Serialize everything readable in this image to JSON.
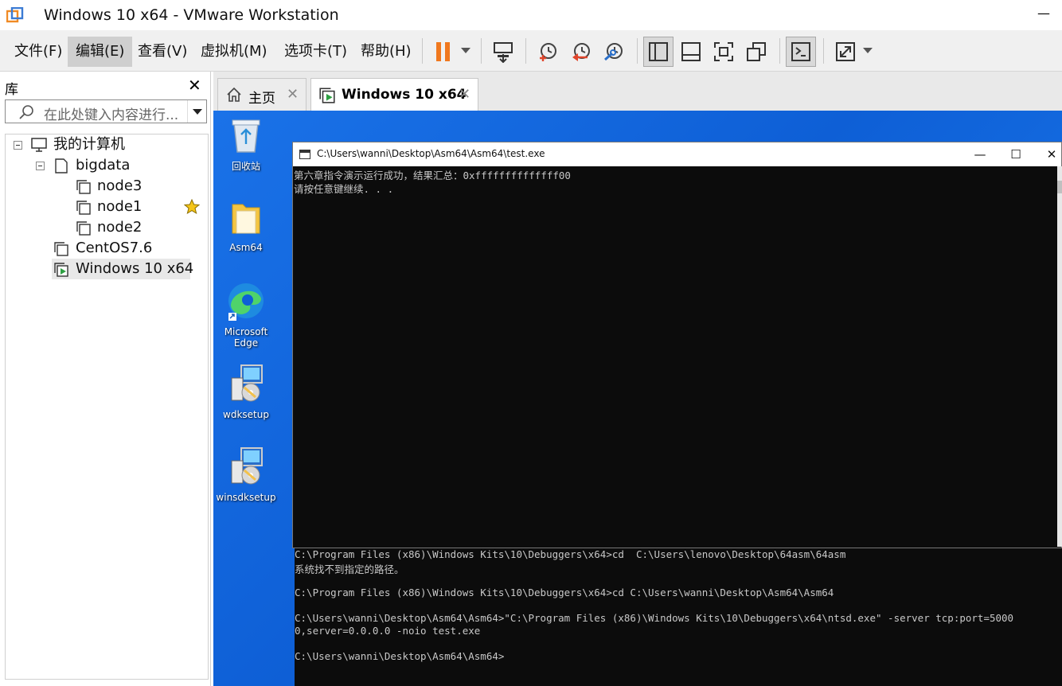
{
  "window": {
    "title": "Windows 10 x64 - VMware Workstation",
    "minimize_glyph": "—"
  },
  "menu": {
    "items": [
      "文件(F)",
      "编辑(E)",
      "查看(V)",
      "虚拟机(M)",
      "选项卡(T)",
      "帮助(H)"
    ],
    "active": "编辑(E)"
  },
  "toolbar": {
    "icons": [
      "pause-icon",
      "send-ctrl-alt-del-icon",
      "snapshot-take-icon",
      "snapshot-revert-icon",
      "snapshot-manager-icon",
      "library-view-icon",
      "thumbnail-bar-icon",
      "full-screen-icon",
      "unity-icon",
      "console-view-icon",
      "stretch-guest-icon"
    ],
    "accent": "#f0781e"
  },
  "library": {
    "title": "库",
    "close_glyph": "✕",
    "search_placeholder": "在此处键入内容进行...",
    "tree": [
      {
        "label": "我的计算机",
        "level": 0,
        "type": "computer",
        "expanded": true
      },
      {
        "label": "bigdata",
        "level": 1,
        "type": "folder",
        "expanded": true
      },
      {
        "label": "node3",
        "level": 2,
        "type": "vm"
      },
      {
        "label": "node1",
        "level": 2,
        "type": "vm",
        "favorite": true
      },
      {
        "label": "node2",
        "level": 2,
        "type": "vm"
      },
      {
        "label": "CentOS7.6",
        "level": 1,
        "type": "vm"
      },
      {
        "label": "Windows 10 x64",
        "level": 1,
        "type": "vm-running",
        "selected": true
      }
    ]
  },
  "tabs": [
    {
      "label": "主页",
      "icon": "home-icon",
      "active": false
    },
    {
      "label": "Windows 10 x64",
      "icon": "vm-running-icon",
      "active": true
    }
  ],
  "tab_close_glyph": "✕",
  "desktop": {
    "icons": [
      {
        "label": "回收站",
        "icon": "recycle-bin-icon"
      },
      {
        "label": "Asm64",
        "icon": "folder-icon"
      },
      {
        "label": "Microsoft Edge",
        "icon": "edge-icon"
      },
      {
        "label": "wdksetup",
        "icon": "installer-icon"
      },
      {
        "label": "winsdksetup",
        "icon": "installer-icon"
      }
    ],
    "background": "#1a72e8"
  },
  "console_front": {
    "title": "C:\\Users\\wanni\\Desktop\\Asm64\\Asm64\\test.exe",
    "lines": [
      "第六章指令演示运行成功，结果汇总：0xffffffffffffff00",
      "请按任意键继续. . ."
    ],
    "buttons": {
      "min": "—",
      "max": "☐",
      "close": "✕"
    }
  },
  "console_back": {
    "lines": [
      "C:\\Program Files (x86)\\Windows Kits\\10\\Debuggers\\x64>cd  C:\\Users\\lenovo\\Desktop\\64asm\\64asm",
      "系统找不到指定的路径。",
      "",
      "C:\\Program Files (x86)\\Windows Kits\\10\\Debuggers\\x64>cd C:\\Users\\wanni\\Desktop\\Asm64\\Asm64",
      "",
      "C:\\Users\\wanni\\Desktop\\Asm64\\Asm64>\"C:\\Program Files (x86)\\Windows Kits\\10\\Debuggers\\x64\\ntsd.exe\" -server tcp:port=5000",
      "0,server=0.0.0.0 -noio test.exe",
      "",
      "C:\\Users\\wanni\\Desktop\\Asm64\\Asm64>"
    ]
  }
}
